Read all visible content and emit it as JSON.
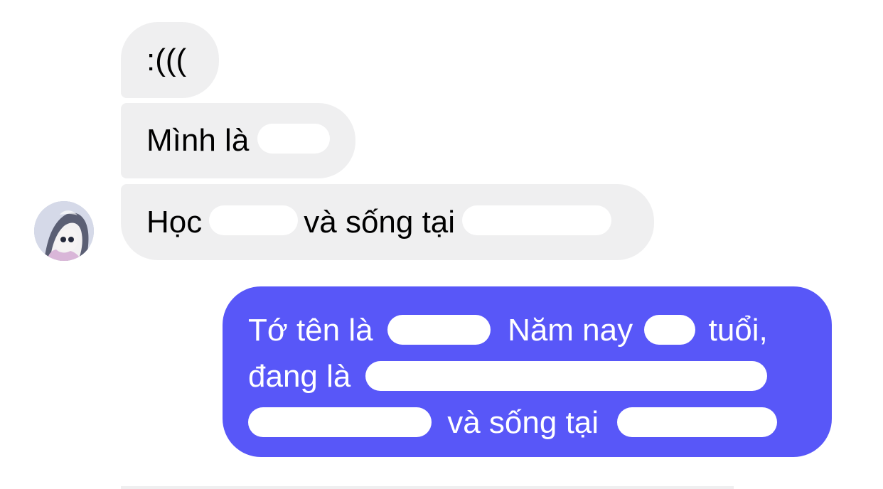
{
  "conversation": {
    "incoming": {
      "message_1": ":(((",
      "message_2_prefix": "Mình là",
      "message_3_prefix": "Học",
      "message_3_middle": "và sống tại"
    },
    "outgoing": {
      "line_1_prefix": "Tớ tên là",
      "line_1_middle": "Năm nay",
      "line_1_suffix": "tuổi,",
      "line_2_prefix": "đang là",
      "line_3_middle": "và sống tại"
    }
  },
  "avatar": {
    "icon": "avatar-icon"
  }
}
